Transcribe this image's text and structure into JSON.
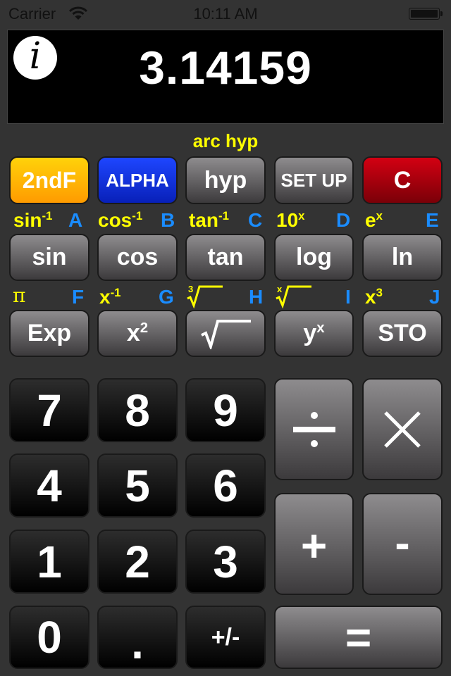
{
  "status_bar": {
    "carrier": "Carrier",
    "time": "10:11 AM",
    "wifi_icon": "wifi-icon",
    "battery_icon": "battery-full-icon"
  },
  "display": {
    "value": "3.14159",
    "info_icon": "info-icon",
    "info_glyph": "i"
  },
  "mode_label": "arc hyp",
  "colors": {
    "background": "#333333",
    "secondary_label": "#ffff00",
    "alpha_label": "#1a8cff",
    "second_fn_key": "#ffb400",
    "alpha_key": "#1030e0",
    "clear_key": "#b00010"
  },
  "row1": [
    {
      "label": "2ndF"
    },
    {
      "label": "ALPHA"
    },
    {
      "label": "hyp"
    },
    {
      "label": "SET UP"
    },
    {
      "label": "C"
    }
  ],
  "row2_labels": [
    {
      "fn": "sin",
      "fn_sup": "-1",
      "alpha": "A"
    },
    {
      "fn": "cos",
      "fn_sup": "-1",
      "alpha": "B"
    },
    {
      "fn": "tan",
      "fn_sup": "-1",
      "alpha": "C"
    },
    {
      "fn": "10",
      "fn_sup": "x",
      "alpha": "D"
    },
    {
      "fn": "e",
      "fn_sup": "x",
      "alpha": "E"
    }
  ],
  "row2": [
    {
      "label": "sin"
    },
    {
      "label": "cos"
    },
    {
      "label": "tan"
    },
    {
      "label": "log"
    },
    {
      "label": "ln"
    }
  ],
  "row3_labels": [
    {
      "fn": "π",
      "fn_sup": "",
      "alpha": "F"
    },
    {
      "fn": "x",
      "fn_sup": "-1",
      "alpha": "G"
    },
    {
      "fn": "√",
      "fn_sup": "3",
      "alpha": "H"
    },
    {
      "fn": "√",
      "fn_sup": "x",
      "alpha": "I"
    },
    {
      "fn": "x",
      "fn_sup": "3",
      "alpha": "J"
    }
  ],
  "row3": [
    {
      "label": "Exp"
    },
    {
      "label": "x",
      "sup": "2"
    },
    {
      "label": "√"
    },
    {
      "label": "y",
      "sup": "x"
    },
    {
      "label": "STO"
    }
  ],
  "numpad": {
    "digits": [
      "7",
      "8",
      "9",
      "4",
      "5",
      "6",
      "1",
      "2",
      "3",
      "0",
      ".",
      "+/-"
    ],
    "divide": "÷",
    "multiply": "×",
    "plus": "+",
    "minus": "-",
    "equals": "="
  }
}
